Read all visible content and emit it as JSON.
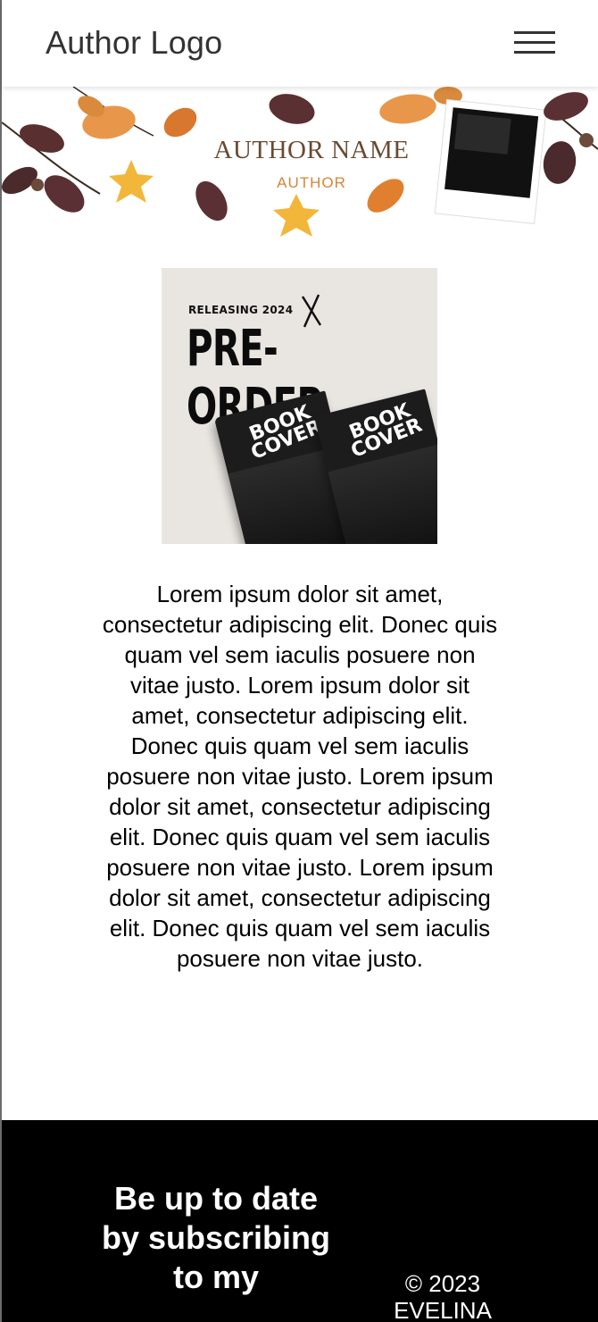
{
  "header": {
    "logo_text": "Author Logo",
    "menu_icon": "hamburger-menu-icon"
  },
  "banner": {
    "author_name": "AUTHOR NAME",
    "author_role": "AUTHOR",
    "decoration": "autumn-leaves-and-polaroid-photo",
    "colors": {
      "name": "#6a4a32",
      "role": "#d2873a"
    }
  },
  "book_promo": {
    "releasing_text": "RELEASING 2024",
    "headline": "PRE-ORDER",
    "book_cover_title": [
      "BOOK",
      "COVER"
    ]
  },
  "main": {
    "paragraph": "Lorem ipsum dolor sit amet, consectetur adipiscing elit. Donec quis quam vel sem iaculis posuere non vitae justo. Lorem ipsum dolor sit amet, consectetur adipiscing elit. Donec quis quam vel sem iaculis posuere non vitae justo. Lorem ipsum dolor sit amet, consectetur adipiscing elit. Donec quis quam vel sem iaculis posuere non vitae justo. Lorem ipsum dolor sit amet, consectetur adipiscing elit. Donec quis quam vel sem iaculis posuere non vitae justo."
  },
  "footer": {
    "subscribe_text": "Be up to date by subscribing to my",
    "copyright": "© 2023 EVELINA",
    "background": "#000000"
  }
}
